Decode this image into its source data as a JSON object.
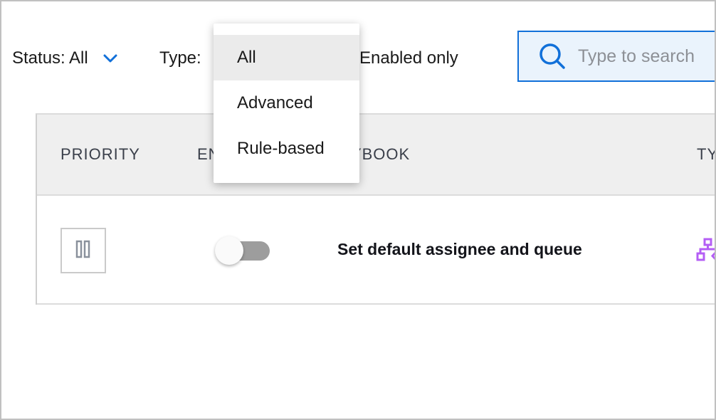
{
  "filters": {
    "status_label": "Status: All",
    "status_icon": "chevron-down-icon",
    "type_label": "Type:",
    "enabled_label": "Enabled only"
  },
  "search": {
    "icon": "search-icon",
    "placeholder": "Type to search",
    "value": ""
  },
  "type_menu": {
    "options": [
      {
        "label": "All",
        "selected": true
      },
      {
        "label": "Advanced",
        "selected": false
      },
      {
        "label": "Rule-based",
        "selected": false
      }
    ]
  },
  "table": {
    "columns": [
      "PRIORITY",
      "ENABLED",
      "PLAYBOOK",
      "TYPE"
    ],
    "rows": [
      {
        "priority_icon": "drag-handle-icon",
        "enabled": false,
        "playbook": "Set default assignee and queue",
        "type_icon": "workflow-icon"
      }
    ]
  },
  "colors": {
    "accent": "#1170d9",
    "search_bg": "#eaf3fc",
    "header_bg": "#efefef",
    "type_icon": "#b45ef5",
    "toggle_track_off": "#9d9d9d"
  }
}
